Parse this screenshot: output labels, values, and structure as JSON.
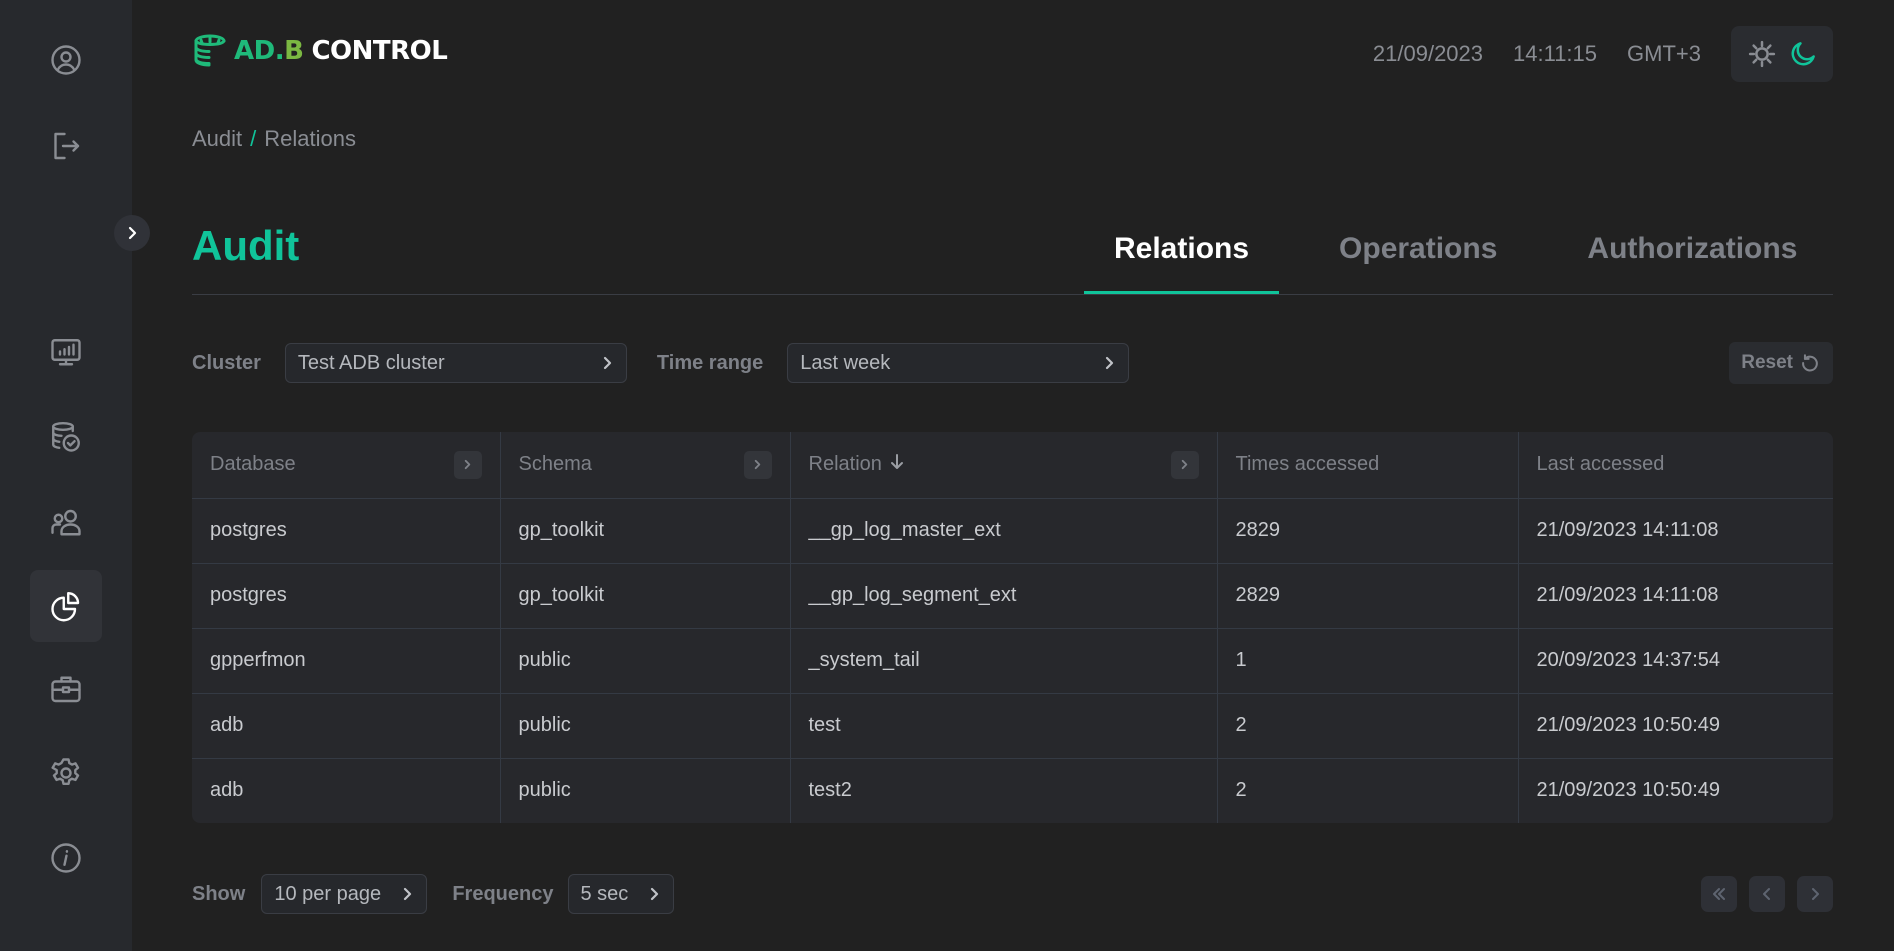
{
  "app": {
    "logo_ad": "AD",
    "logo_dot": ".",
    "logo_b": "B",
    "logo_control": "CONTROL",
    "accent_color": "#10c49a"
  },
  "header": {
    "date": "21/09/2023",
    "time": "14:11:15",
    "timezone": "GMT+3",
    "theme": {
      "light_icon": "sun-icon",
      "dark_icon": "moon-icon",
      "active": "dark"
    }
  },
  "sidebar": {
    "top_items": [
      {
        "name": "profile",
        "icon": "user-circle-icon"
      },
      {
        "name": "logout",
        "icon": "logout-icon"
      }
    ],
    "expand_icon": "chevron-right-icon",
    "items": [
      {
        "name": "monitoring",
        "icon": "monitor-chart-icon",
        "active": false
      },
      {
        "name": "backups",
        "icon": "database-check-icon",
        "active": false
      },
      {
        "name": "users",
        "icon": "users-icon",
        "active": false
      },
      {
        "name": "audit",
        "icon": "pie-chart-icon",
        "active": true
      },
      {
        "name": "jobs",
        "icon": "briefcase-icon",
        "active": false
      },
      {
        "name": "settings",
        "icon": "gear-icon",
        "active": false
      },
      {
        "name": "info",
        "icon": "info-icon",
        "active": false
      }
    ]
  },
  "breadcrumb": {
    "items": [
      "Audit",
      "Relations"
    ],
    "separator": "/"
  },
  "page": {
    "title": "Audit",
    "tabs": [
      {
        "label": "Relations",
        "active": true
      },
      {
        "label": "Operations",
        "active": false
      },
      {
        "label": "Authorizations",
        "active": false
      }
    ]
  },
  "filters": {
    "cluster_label": "Cluster",
    "cluster_value": "Test ADB cluster",
    "time_range_label": "Time range",
    "time_range_value": "Last week",
    "reset_label": "Reset"
  },
  "table": {
    "columns": [
      {
        "label": "Database",
        "filter": true,
        "sort": null
      },
      {
        "label": "Schema",
        "filter": true,
        "sort": null
      },
      {
        "label": "Relation",
        "filter": true,
        "sort": "desc"
      },
      {
        "label": "Times accessed",
        "filter": false,
        "sort": null
      },
      {
        "label": "Last accessed",
        "filter": false,
        "sort": null
      }
    ],
    "rows": [
      [
        "postgres",
        "gp_toolkit",
        "__gp_log_master_ext",
        "2829",
        "21/09/2023 14:11:08"
      ],
      [
        "postgres",
        "gp_toolkit",
        "__gp_log_segment_ext",
        "2829",
        "21/09/2023 14:11:08"
      ],
      [
        "gpperfmon",
        "public",
        "_system_tail",
        "1",
        "20/09/2023 14:37:54"
      ],
      [
        "adb",
        "public",
        "test",
        "2",
        "21/09/2023 10:50:49"
      ],
      [
        "adb",
        "public",
        "test2",
        "2",
        "21/09/2023 10:50:49"
      ]
    ]
  },
  "footer": {
    "show_label": "Show",
    "show_value": "10 per page",
    "frequency_label": "Frequency",
    "frequency_value": "5 sec",
    "pager": [
      "first-page-icon",
      "prev-page-icon",
      "next-page-icon"
    ]
  }
}
